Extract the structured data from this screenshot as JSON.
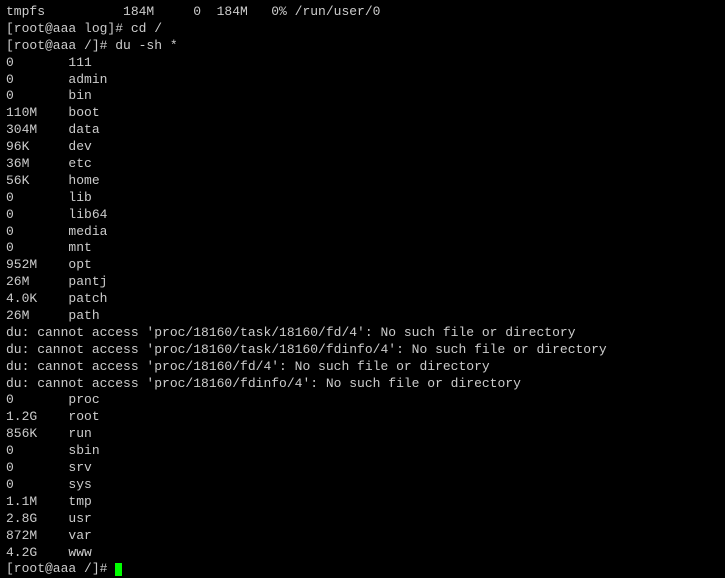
{
  "top_partial": "tmpfs          184M     0  184M   0% /run/user/0",
  "prompts": {
    "p1": "[root@aaa log]# ",
    "p2": "[root@aaa /]# ",
    "p3": "[root@aaa /]# "
  },
  "commands": {
    "c1": "cd /",
    "c2": "du -sh *"
  },
  "du_rows1": [
    {
      "size": "0",
      "name": "111"
    },
    {
      "size": "0",
      "name": "admin"
    },
    {
      "size": "0",
      "name": "bin"
    },
    {
      "size": "110M",
      "name": "boot"
    },
    {
      "size": "304M",
      "name": "data"
    },
    {
      "size": "96K",
      "name": "dev"
    },
    {
      "size": "36M",
      "name": "etc"
    },
    {
      "size": "56K",
      "name": "home"
    },
    {
      "size": "0",
      "name": "lib"
    },
    {
      "size": "0",
      "name": "lib64"
    },
    {
      "size": "0",
      "name": "media"
    },
    {
      "size": "0",
      "name": "mnt"
    },
    {
      "size": "952M",
      "name": "opt"
    },
    {
      "size": "26M",
      "name": "pantj"
    },
    {
      "size": "4.0K",
      "name": "patch"
    },
    {
      "size": "26M",
      "name": "path"
    }
  ],
  "errors": [
    "du: cannot access 'proc/18160/task/18160/fd/4': No such file or directory",
    "du: cannot access 'proc/18160/task/18160/fdinfo/4': No such file or directory",
    "du: cannot access 'proc/18160/fd/4': No such file or directory",
    "du: cannot access 'proc/18160/fdinfo/4': No such file or directory"
  ],
  "du_rows2": [
    {
      "size": "0",
      "name": "proc"
    },
    {
      "size": "1.2G",
      "name": "root"
    },
    {
      "size": "856K",
      "name": "run"
    },
    {
      "size": "0",
      "name": "sbin"
    },
    {
      "size": "0",
      "name": "srv"
    },
    {
      "size": "0",
      "name": "sys"
    },
    {
      "size": "1.1M",
      "name": "tmp"
    },
    {
      "size": "2.8G",
      "name": "usr"
    },
    {
      "size": "872M",
      "name": "var"
    },
    {
      "size": "4.2G",
      "name": "www"
    }
  ]
}
